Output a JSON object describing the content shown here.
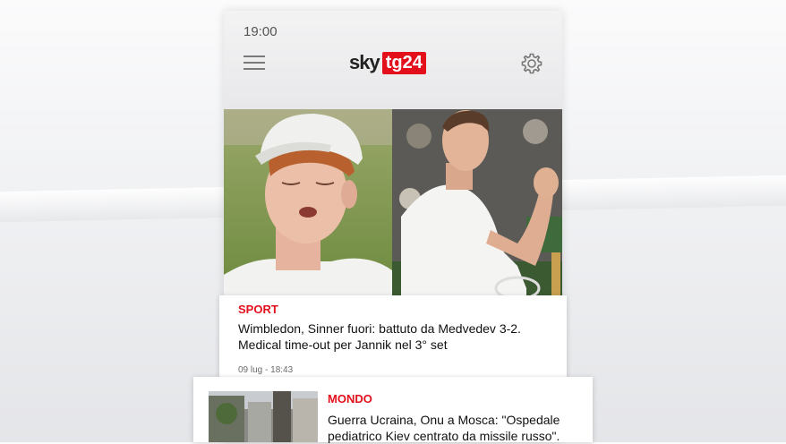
{
  "status_bar": {
    "time": "19:00"
  },
  "header": {
    "logo_sky": "sky",
    "logo_tg": "tg24",
    "menu_icon": "hamburger-menu-icon",
    "settings_icon": "gear-icon"
  },
  "articles": [
    {
      "category": "SPORT",
      "title_line1": "Wimbledon, Sinner fuori: battuto da Medvedev 3-2.",
      "title_line2": "Medical time-out per Jannik nel 3° set",
      "timestamp": "09 lug - 18:43"
    },
    {
      "category": "MONDO",
      "title_line1": "Guerra Ucraina, Onu a Mosca: \"Ospedale",
      "title_line2": "pediatrico Kiev centrato da missile russo\"."
    }
  ],
  "colors": {
    "accent_red": "#e3101c",
    "text_dark": "#111111",
    "header_bg": "#ececee"
  }
}
